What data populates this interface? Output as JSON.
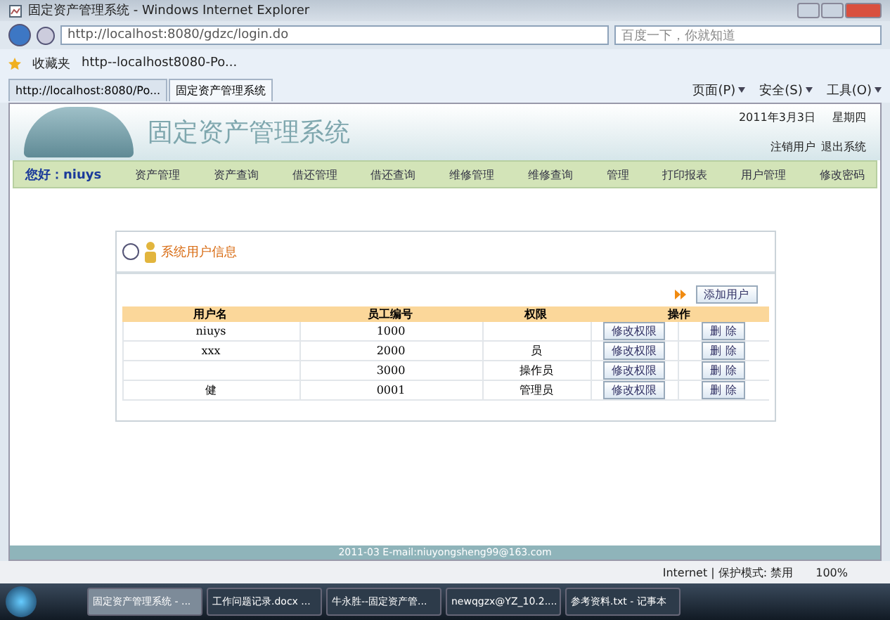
{
  "window": {
    "title": "固定资产管理系统 - Windows Internet Explorer"
  },
  "address_bar": {
    "url": "http://localhost:8080/gdzc/login.do"
  },
  "search": {
    "placeholder": "百度一下，你就知道"
  },
  "favorites_bar": {
    "label": "收藏夹",
    "items": [
      "http--localhost8080-Po..."
    ]
  },
  "tabs": [
    {
      "label": "http://localhost:8080/Po...",
      "selected": false
    },
    {
      "label": "固定资产管理系统",
      "selected": true
    }
  ],
  "command_bar": [
    "页面(P)",
    "安全(S)",
    "工具(O)"
  ],
  "header": {
    "title": "固定资产管理系统",
    "date": "2011年3月3日",
    "weekday": "星期四",
    "links": [
      "注销用户",
      "退出系统"
    ]
  },
  "nav": {
    "greeting": "您好：niuys",
    "items": [
      "资产管理",
      "资产查询",
      "借还管理",
      "借还查询",
      "维修管理",
      "维修查询",
      "管理",
      "打印报表",
      "用户管理",
      "修改密码"
    ]
  },
  "panel": {
    "title": "系统用户信息",
    "add_button": "添加用户",
    "columns": [
      "用户名",
      "员工编号",
      "权限",
      "操作"
    ],
    "rows": [
      {
        "name": "niuys",
        "id": "1000",
        "edit": "修改权限",
        "delete": "删 除"
      },
      {
        "name": "xxx",
        "id": "2000",
        "role": "员",
        "edit": "修改权限",
        "delete": "删 除"
      },
      {
        "id": "3000",
        "role": "操作员",
        "edit": "修改权限",
        "delete": "删 除"
      },
      {
        "name": "健",
        "id": "0001",
        "role": "管理员",
        "edit": "修改权限",
        "delete": "删 除"
      }
    ]
  },
  "footer": "2011-03 E-mail:niuyongsheng99@163.com",
  "status_bar": {
    "zone": "Internet | 保护模式: 禁用",
    "zoom": "100%"
  },
  "taskbar": [
    {
      "label": "固定资产管理系统 - ...",
      "selected": true
    },
    {
      "label": "工作问题记录.docx ...",
      "selected": false
    },
    {
      "label": "牛永胜--固定资产管...",
      "selected": false
    },
    {
      "label": "newqgzx@YZ_10.2....",
      "selected": false
    },
    {
      "label": "参考资料.txt - 记事本",
      "selected": false
    }
  ]
}
